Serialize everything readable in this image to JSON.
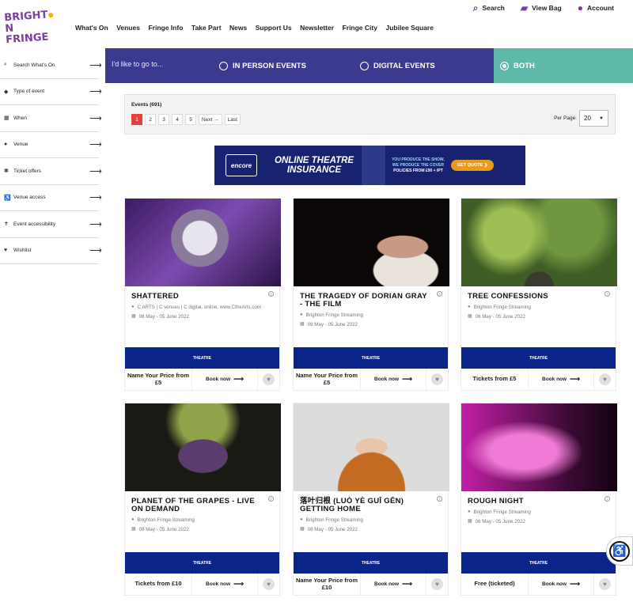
{
  "header": {
    "logo_line1": "BRIGHT",
    "logo_line1b": "N",
    "logo_line2": "FRINGE",
    "nav": [
      "What's On",
      "Venues",
      "Fringe Info",
      "Take Part",
      "News",
      "Support Us",
      "Newsletter",
      "Fringe City",
      "Jubilee Square"
    ],
    "util": {
      "search": "Search",
      "bag": "View Bag",
      "account": "Account"
    }
  },
  "sidebar": {
    "items": [
      {
        "label": "Search What's On",
        "icon": "search-icon",
        "glyph": "⌕"
      },
      {
        "label": "Type of event",
        "icon": "tag-icon",
        "glyph": "◆"
      },
      {
        "label": "When",
        "icon": "calendar-icon",
        "glyph": "▦"
      },
      {
        "label": "Venue",
        "icon": "pin-icon",
        "glyph": "●"
      },
      {
        "label": "Ticket offers",
        "icon": "ticket-icon",
        "glyph": "✽"
      },
      {
        "label": "Venue access",
        "icon": "access-icon",
        "glyph": "♿"
      },
      {
        "label": "Event accessibility",
        "icon": "accessibility-icon",
        "glyph": "✝"
      },
      {
        "label": "Wishlist",
        "icon": "heart-icon",
        "glyph": "♥"
      }
    ]
  },
  "filter": {
    "go_placeholder": "I'd like to go to...",
    "in_person": "IN PERSON EVENTS",
    "digital": "DIGITAL EVENTS",
    "both": "BOTH",
    "selected": "BOTH"
  },
  "pagination": {
    "count": "Events (691)",
    "pages": [
      "1",
      "2",
      "3",
      "4",
      "5",
      "Next →",
      "Last"
    ],
    "current": "1",
    "per_page_label": "Per Page:",
    "per_page": "20"
  },
  "banner": {
    "brand": "encore",
    "headline1": "ONLINE THEATRE",
    "headline2": "INSURANCE",
    "tag1": "YOU PRODUCE THE SHOW,",
    "tag2": "WE PRODUCE THE COVER",
    "tag3": "POLICIES FROM £90 + IPT",
    "cta": "GET QUOTE ❯"
  },
  "events": [
    {
      "title": "SHATTERED",
      "venue": "C ARTS | C venues | C digital, online, www.CtheArts.com",
      "dates": "06 May - 05 June 2022",
      "category": "THEATRE",
      "price": "Name Your Price from £5",
      "book": "Book now",
      "img": "purple"
    },
    {
      "title": "THE TRAGEDY OF DORIAN GRAY - THE FILM",
      "venue": "Brighton Fringe Streaming",
      "dates": "06 May - 05 June 2022",
      "category": "THEATRE",
      "price": "Name Your Price from £5",
      "book": "Book now",
      "img": "dorian"
    },
    {
      "title": "TREE CONFESSIONS",
      "venue": "Brighton Fringe Streaming",
      "dates": "06 May - 05 June 2022",
      "category": "THEATRE",
      "price": "Tickets from £5",
      "book": "Book now",
      "img": "tree"
    },
    {
      "title": "PLANET OF THE GRAPES - LIVE ON DEMAND",
      "venue": "Brighton Fringe Streaming",
      "dates": "06 May - 05 June 2022",
      "category": "THEATRE",
      "price": "Tickets from £10",
      "book": "Book now",
      "img": "grapes"
    },
    {
      "title": "落叶归根 (LUÒ YÈ GUĪ GĒN) GETTING HOME",
      "venue": "Brighton Fringe Streaming",
      "dates": "06 May - 05 June 2022",
      "category": "THEATRE",
      "price": "Name Your Price from £10",
      "book": "Book now",
      "img": "getting"
    },
    {
      "title": "ROUGH NIGHT",
      "venue": "Brighton Fringe Streaming",
      "dates": "06 May - 05 June 2022",
      "category": "THEATRE",
      "price": "Free (ticketed)",
      "book": "Book now",
      "img": "rough"
    }
  ],
  "colors": {
    "brand": "#7b3fa0",
    "filter_bar": "#3c3a8f",
    "both": "#5fb9a9",
    "category": "#0b2489",
    "active_page": "#e5413b"
  }
}
